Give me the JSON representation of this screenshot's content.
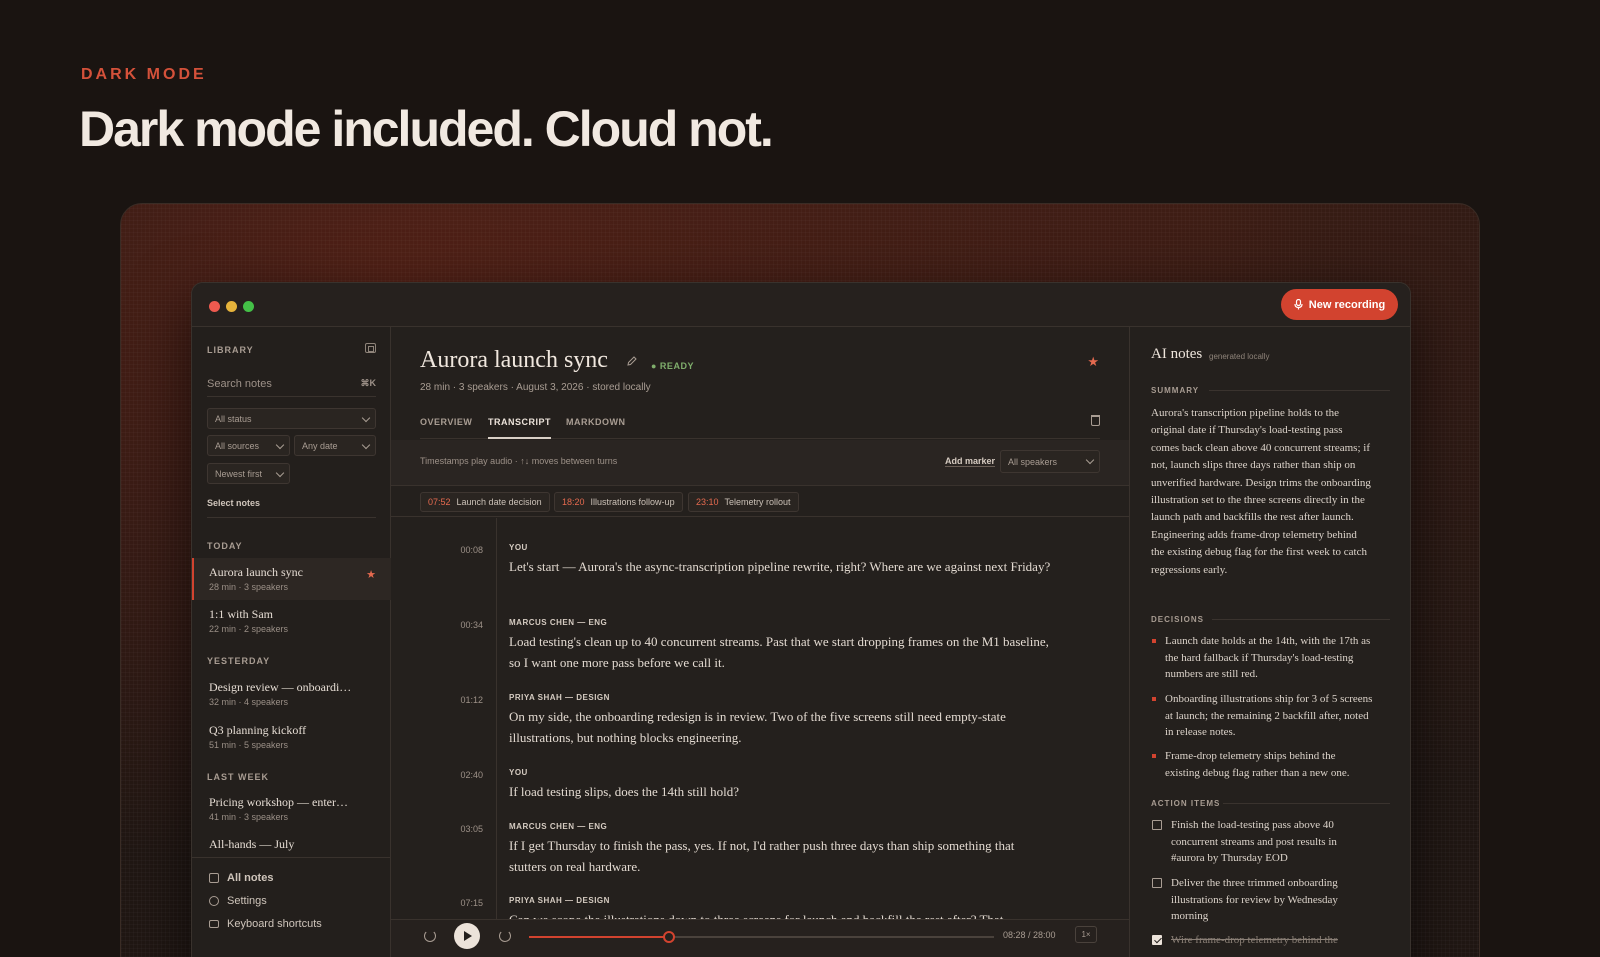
{
  "hero": {
    "eyebrow": "DARK MODE",
    "title": "Dark mode included. Cloud not."
  },
  "window": {
    "new_recording_label": "New recording",
    "accent": "#d2432f"
  },
  "sidebar": {
    "heading": "LIBRARY",
    "search_placeholder": "Search notes",
    "search_shortcut": "⌘K",
    "filters": {
      "status": "All status",
      "sources": "All sources",
      "date": "Any date",
      "sort": "Newest first"
    },
    "select_notes": "Select notes",
    "groups": [
      {
        "label": "TODAY",
        "items": [
          {
            "title": "Aurora launch sync",
            "meta": "28 min · 3 speakers",
            "starred": true,
            "active": true
          },
          {
            "title": "1:1 with Sam",
            "meta": "22 min · 2 speakers"
          }
        ]
      },
      {
        "label": "YESTERDAY",
        "items": [
          {
            "title": "Design review — onboardi…",
            "meta": "32 min · 4 speakers"
          },
          {
            "title": "Q3 planning kickoff",
            "meta": "51 min · 5 speakers"
          }
        ]
      },
      {
        "label": "LAST WEEK",
        "items": [
          {
            "title": "Pricing workshop — enter…",
            "meta": "41 min · 3 speakers"
          },
          {
            "title": "All-hands — July",
            "meta": ""
          }
        ]
      }
    ],
    "links": [
      {
        "label": "All notes",
        "icon": "file-icon"
      },
      {
        "label": "Settings",
        "icon": "gear-icon"
      },
      {
        "label": "Keyboard shortcuts",
        "icon": "keyboard-icon"
      }
    ]
  },
  "document": {
    "title": "Aurora launch sync",
    "status": "● READY",
    "meta": "28 min · 3 speakers · August 3, 2026 · stored locally",
    "tabs": [
      "OVERVIEW",
      "TRANSCRIPT",
      "MARKDOWN"
    ],
    "active_tab": "TRANSCRIPT",
    "hint": "Timestamps play audio · ↑↓ moves between turns",
    "add_marker": "Add marker",
    "speaker_filter": "All speakers",
    "markers": [
      {
        "time": "07:52",
        "label": "Launch date decision"
      },
      {
        "time": "18:20",
        "label": "Illustrations follow-up"
      },
      {
        "time": "23:10",
        "label": "Telemetry rollout"
      }
    ],
    "turns": [
      {
        "time": "00:08",
        "speaker": "YOU",
        "text": "Let's start — Aurora's the async-transcription pipeline rewrite, right? Where are we against next Friday?"
      },
      {
        "time": "00:34",
        "speaker": "MARCUS CHEN — ENG",
        "text": "Load testing's clean up to 40 concurrent streams. Past that we start dropping frames on the M1 baseline, so I want one more pass before we call it."
      },
      {
        "time": "01:12",
        "speaker": "PRIYA SHAH — DESIGN",
        "text": "On my side, the onboarding redesign is in review. Two of the five screens still need empty-state illustrations, but nothing blocks engineering."
      },
      {
        "time": "02:40",
        "speaker": "YOU",
        "text": "If load testing slips, does the 14th still hold?"
      },
      {
        "time": "03:05",
        "speaker": "MARCUS CHEN — ENG",
        "text": "If I get Thursday to finish the pass, yes. If not, I'd rather push three days than ship something that stutters on real hardware."
      },
      {
        "time": "07:15",
        "speaker": "PRIYA SHAH — DESIGN",
        "text": "Can we scope the illustrations down to three screens for launch and backfill the rest after? That"
      }
    ],
    "player": {
      "time": "08:28 / 28:00",
      "rate": "1×",
      "progress": 0.3
    }
  },
  "ai_notes": {
    "title": "AI notes",
    "subtitle": "generated locally",
    "summary_heading": "SUMMARY",
    "summary": "Aurora's transcription pipeline holds to the original date if Thursday's load-testing pass comes back clean above 40 concurrent streams; if not, launch slips three days rather than ship on unverified hardware. Design trims the onboarding illustration set to the three screens directly in the launch path and backfills the rest after launch. Engineering adds frame-drop telemetry behind the existing debug flag for the first week to catch regressions early.",
    "decisions_heading": "DECISIONS",
    "decisions": [
      "Launch date holds at the 14th, with the 17th as the hard fallback if Thursday's load-testing numbers are still red.",
      "Onboarding illustrations ship for 3 of 5 screens at launch; the remaining 2 backfill after, noted in release notes.",
      "Frame-drop telemetry ships behind the existing debug flag rather than a new one."
    ],
    "actions_heading": "ACTION ITEMS",
    "actions": [
      {
        "text": "Finish the load-testing pass above 40 concurrent streams and post results in #aurora by Thursday EOD",
        "done": false
      },
      {
        "text": "Deliver the three trimmed onboarding illustrations for review by Wednesday morning",
        "done": false
      },
      {
        "text": "Wire frame-drop telemetry behind the",
        "done": true
      }
    ]
  }
}
